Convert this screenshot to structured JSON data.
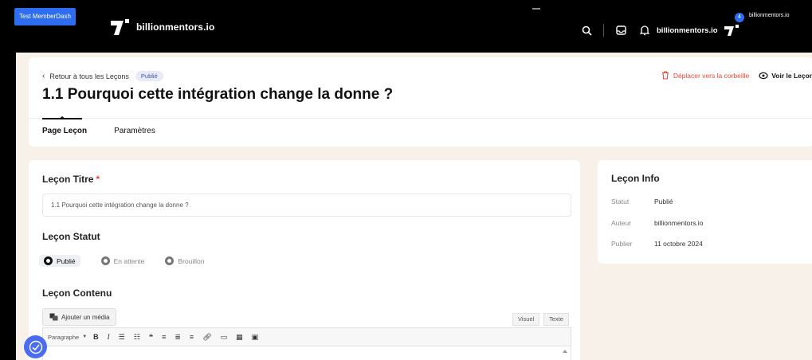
{
  "admin_bar": {
    "site_chip": "Test MemberDash"
  },
  "topbar": {
    "brand_name": "billionmentors.io",
    "site_link": "billionmentors.io",
    "notification_count": "4",
    "user_name": "billionmentors.io"
  },
  "header": {
    "back_label": "Retour à tous les Leçons",
    "status_pill": "Publié",
    "title": "1.1 Pourquoi cette intégration change la donne ?",
    "trash_label": "Déplacer vers la corbeille",
    "view_label": "Voir le Leçon"
  },
  "tabs": [
    {
      "label": "Page Leçon",
      "active": true
    },
    {
      "label": "Paramètres",
      "active": false
    }
  ],
  "form": {
    "title_label": "Leçon Titre",
    "required_mark": "*",
    "title_value": "1.1 Pourquoi cette intégration change la donne ?",
    "status_label": "Leçon Statut",
    "status_options": [
      {
        "label": "Publié",
        "selected": true
      },
      {
        "label": "En attente",
        "selected": false
      },
      {
        "label": "Brouillon",
        "selected": false
      }
    ],
    "content_label": "Leçon Contenu",
    "add_media_label": "Ajouter un média",
    "visual_tab": "Visuel",
    "text_tab": "Texte",
    "format_select": "Paragraphe"
  },
  "info": {
    "title": "Leçon Info",
    "rows": [
      {
        "key": "Statut",
        "value": "Publié"
      },
      {
        "key": "Auteur",
        "value": "billionmentors.io"
      },
      {
        "key": "Publier",
        "value": "11 octobre 2024"
      }
    ]
  },
  "colors": {
    "accent_blue": "#2e6cf0",
    "danger_red": "#e5483b",
    "panel_bg": "#f8f1ea"
  }
}
